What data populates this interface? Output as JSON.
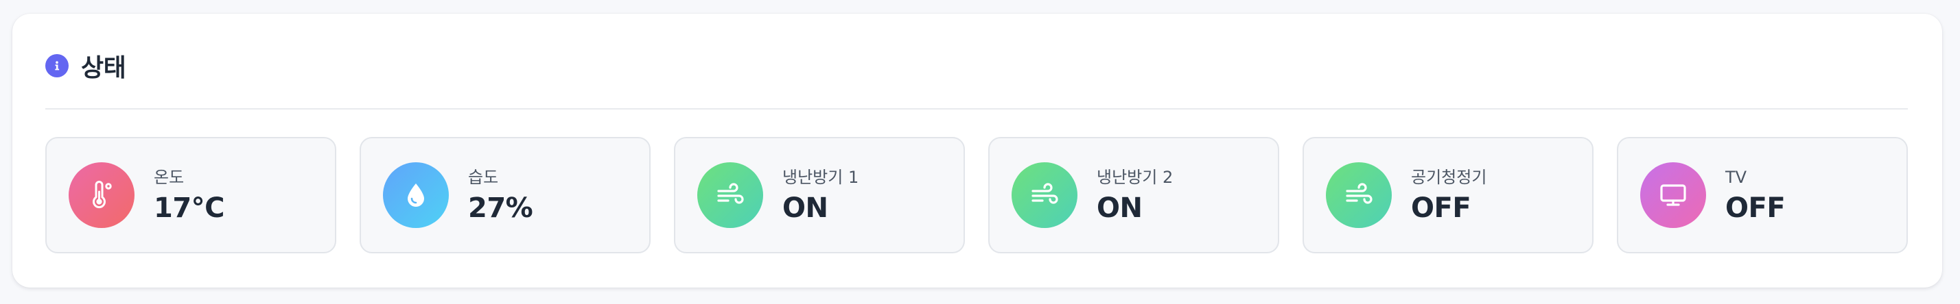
{
  "panel": {
    "title": "상태",
    "icon": "info-icon",
    "accent": "#6366f1"
  },
  "cards": [
    {
      "label": "온도",
      "value": "17°C",
      "icon": "thermometer-icon",
      "colors": [
        "#ec6aa6",
        "#f26a6a"
      ]
    },
    {
      "label": "습도",
      "value": "27%",
      "icon": "droplet-icon",
      "colors": [
        "#60a5fa",
        "#4fd1f5"
      ]
    },
    {
      "label": "냉난방기 1",
      "value": "ON",
      "icon": "wind-icon",
      "colors": [
        "#6ee07f",
        "#4fd1b5"
      ]
    },
    {
      "label": "냉난방기 2",
      "value": "ON",
      "icon": "wind-icon",
      "colors": [
        "#6ee07f",
        "#4fd1b5"
      ]
    },
    {
      "label": "공기청정기",
      "value": "OFF",
      "icon": "wind-icon",
      "colors": [
        "#6ee07f",
        "#4fd1b5"
      ]
    },
    {
      "label": "TV",
      "value": "OFF",
      "icon": "tv-icon",
      "colors": [
        "#c772e8",
        "#ec6ab4"
      ]
    }
  ]
}
